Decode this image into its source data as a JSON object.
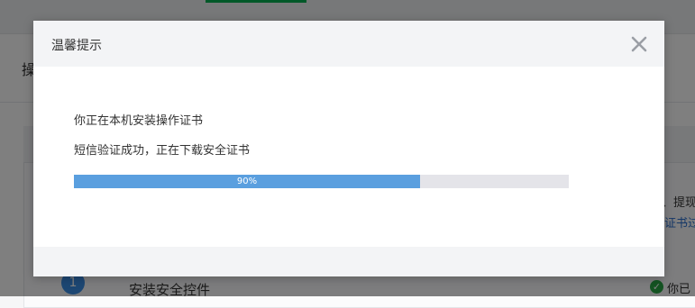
{
  "background": {
    "heading_text": "操",
    "right_text": "、提现",
    "right_link": "证书过",
    "step": {
      "number": "1",
      "label": "安装安全控件",
      "status_text": "你已"
    }
  },
  "dialog": {
    "title": "温馨提示",
    "close_icon": "close-x-icon",
    "message_line1": "你正在本机安装操作证书",
    "message_line2": "短信验证成功，正在下载安全证书",
    "progress": {
      "percent": 0.7,
      "label": "90%"
    }
  },
  "colors": {
    "progress_fill": "#5a9fdf",
    "progress_track": "#e4e4e9",
    "header_bg": "#f3f4f6",
    "link": "#2a6ecf",
    "success": "#29a745"
  }
}
